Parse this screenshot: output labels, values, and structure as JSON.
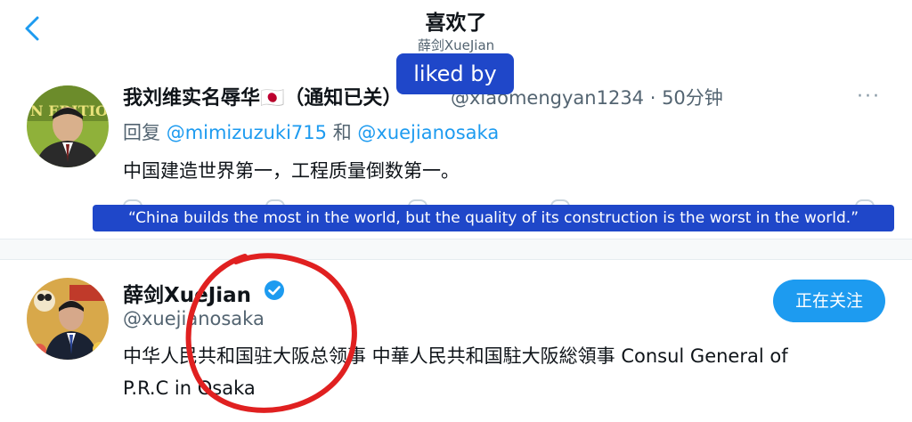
{
  "header": {
    "title": "喜欢了",
    "subtitle": "薛剑XueJian"
  },
  "overlay": {
    "liked_by": "liked by",
    "caption": "“China builds the most in the world, but the quality of its construction is the worst in the world.”"
  },
  "tweet": {
    "display_name": "我刘维实名辱华🇯🇵（通知已关）",
    "handle_time": "@xiaomengyan1234 · 50分钟",
    "reply_prefix": "回复",
    "reply_user1": "@mimizuzuki715",
    "reply_conj": "和",
    "reply_user2": "@xuejianosaka",
    "text": "中国建造世界第一，工程质量倒数第一。",
    "more": "···"
  },
  "user": {
    "name": "薛剑XueJian",
    "handle": "@xuejianosaka",
    "bio": "中华人民共和国驻大阪总领事 中華人民共和国駐大阪総領事 Consul General of P.R.C in Osaka",
    "follow_label": "正在关注"
  },
  "colors": {
    "accent": "#1d9bf0",
    "overlay": "#1f47c9",
    "circle": "#e02020"
  }
}
